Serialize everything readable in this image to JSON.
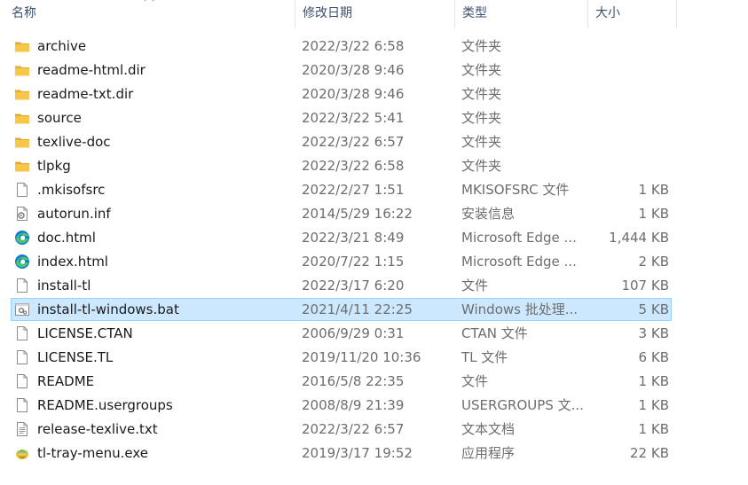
{
  "columns": {
    "name": "名称",
    "date": "修改日期",
    "type": "类型",
    "size": "大小"
  },
  "files": [
    {
      "name": "archive",
      "date": "2022/3/22 6:58",
      "type": "文件夹",
      "size": "",
      "icon": "folder-icon"
    },
    {
      "name": "readme-html.dir",
      "date": "2020/3/28 9:46",
      "type": "文件夹",
      "size": "",
      "icon": "folder-icon"
    },
    {
      "name": "readme-txt.dir",
      "date": "2020/3/28 9:46",
      "type": "文件夹",
      "size": "",
      "icon": "folder-icon"
    },
    {
      "name": "source",
      "date": "2022/3/22 5:41",
      "type": "文件夹",
      "size": "",
      "icon": "folder-icon"
    },
    {
      "name": "texlive-doc",
      "date": "2022/3/22 6:57",
      "type": "文件夹",
      "size": "",
      "icon": "folder-icon"
    },
    {
      "name": "tlpkg",
      "date": "2022/3/22 6:58",
      "type": "文件夹",
      "size": "",
      "icon": "folder-icon"
    },
    {
      "name": ".mkisofsrc",
      "date": "2022/2/27 1:51",
      "type": "MKISOFSRC 文件",
      "size": "1 KB",
      "icon": "file-icon"
    },
    {
      "name": "autorun.inf",
      "date": "2014/5/29 16:22",
      "type": "安装信息",
      "size": "1 KB",
      "icon": "setup-info-icon"
    },
    {
      "name": "doc.html",
      "date": "2022/3/21 8:49",
      "type": "Microsoft Edge ...",
      "size": "1,444 KB",
      "icon": "edge-icon"
    },
    {
      "name": "index.html",
      "date": "2020/7/22 1:15",
      "type": "Microsoft Edge ...",
      "size": "2 KB",
      "icon": "edge-icon"
    },
    {
      "name": "install-tl",
      "date": "2022/3/17 6:20",
      "type": "文件",
      "size": "107 KB",
      "icon": "file-icon"
    },
    {
      "name": "install-tl-windows.bat",
      "date": "2021/4/11 22:25",
      "type": "Windows 批处理...",
      "size": "5 KB",
      "icon": "batch-file-icon",
      "selected": true
    },
    {
      "name": "LICENSE.CTAN",
      "date": "2006/9/29 0:31",
      "type": "CTAN 文件",
      "size": "3 KB",
      "icon": "file-icon"
    },
    {
      "name": "LICENSE.TL",
      "date": "2019/11/20 10:36",
      "type": "TL 文件",
      "size": "6 KB",
      "icon": "file-icon"
    },
    {
      "name": "README",
      "date": "2016/5/8 22:35",
      "type": "文件",
      "size": "1 KB",
      "icon": "file-icon"
    },
    {
      "name": "README.usergroups",
      "date": "2008/8/9 21:39",
      "type": "USERGROUPS 文...",
      "size": "1 KB",
      "icon": "file-icon"
    },
    {
      "name": "release-texlive.txt",
      "date": "2022/3/22 6:57",
      "type": "文本文档",
      "size": "1 KB",
      "icon": "text-document-icon"
    },
    {
      "name": "tl-tray-menu.exe",
      "date": "2019/3/17 19:52",
      "type": "应用程序",
      "size": "22 KB",
      "icon": "application-icon"
    }
  ],
  "colors": {
    "folder": "#f8c74a",
    "folder_dark": "#e8a92c",
    "selection_bg": "#cce8ff",
    "selection_border": "#99d1ff",
    "edge_blue": "#0f7bd6",
    "edge_green": "#4fc36b"
  }
}
